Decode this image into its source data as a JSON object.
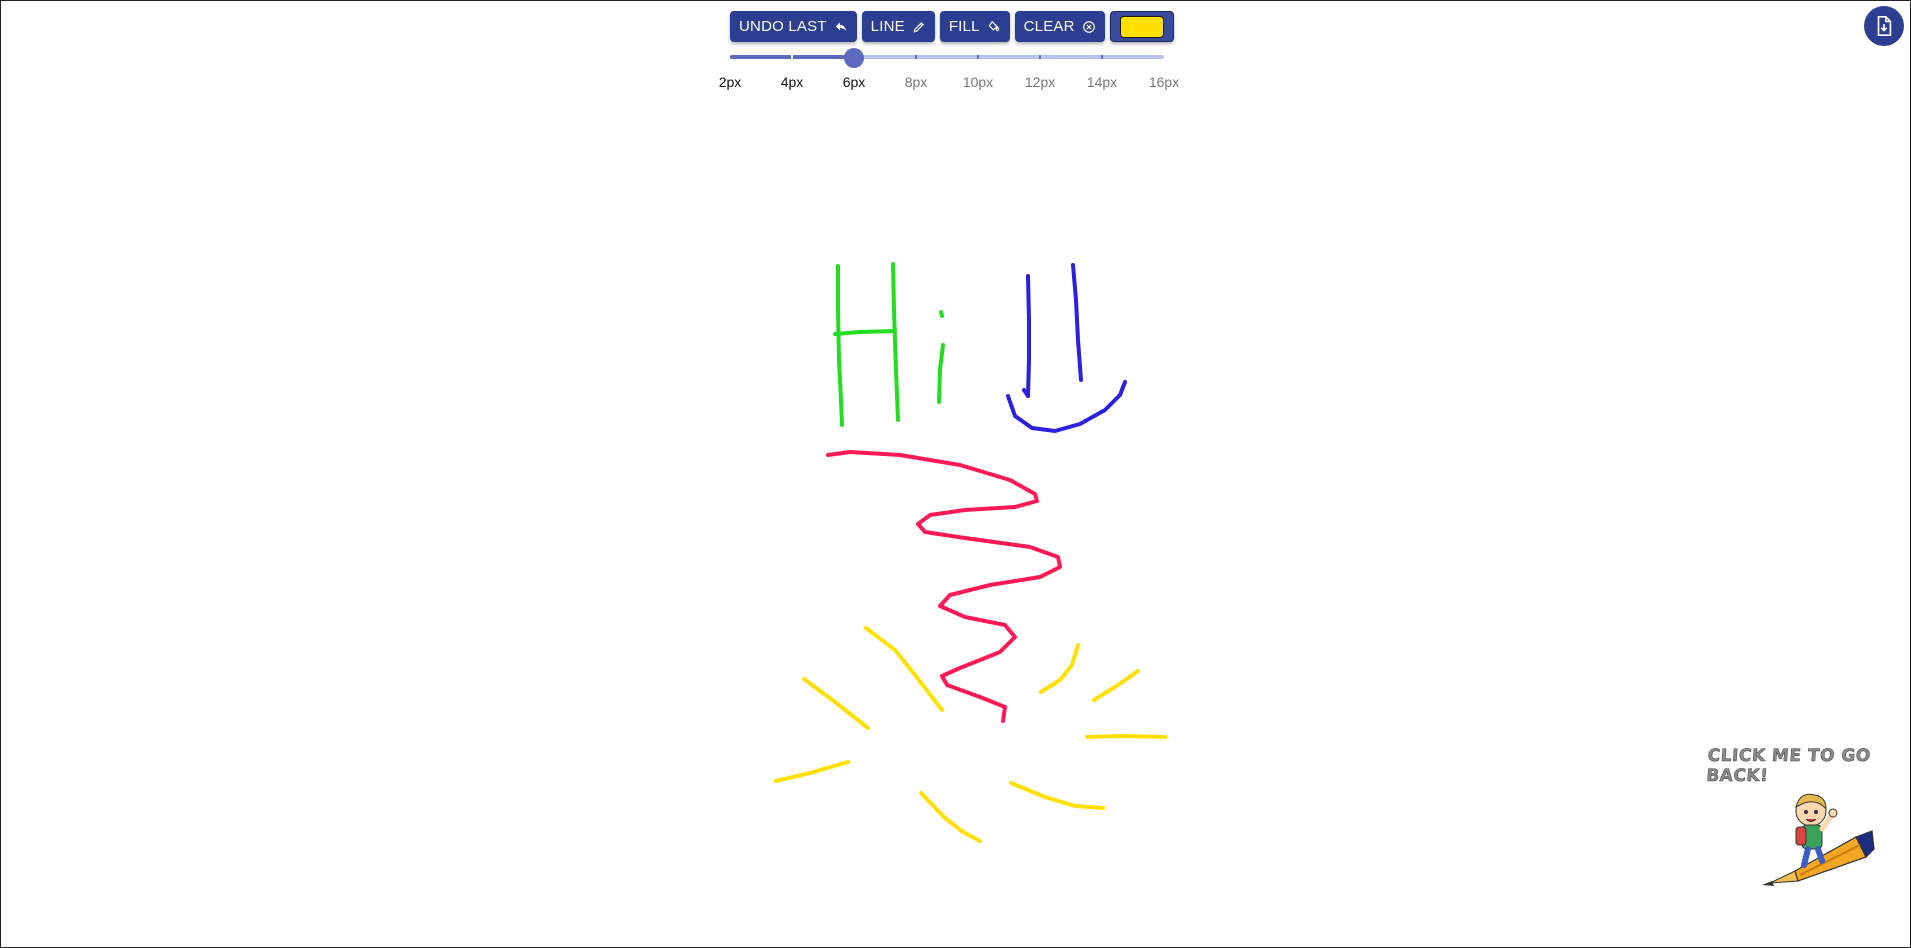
{
  "toolbar": {
    "undo_label": "UNDO LAST",
    "line_label": "LINE",
    "fill_label": "FILL",
    "clear_label": "CLEAR",
    "selected_color": "#ffe000"
  },
  "brush_size": {
    "options": [
      "2px",
      "4px",
      "6px",
      "8px",
      "10px",
      "12px",
      "14px",
      "16px"
    ],
    "selected": "6px",
    "accent": "#5c6bc0"
  },
  "icons": {
    "undo": "undo-arrow-icon",
    "line": "pencil-icon",
    "fill": "paint-bucket-icon",
    "clear": "close-circle-icon",
    "download": "file-download-icon"
  },
  "drawing": {
    "stroke_colors": {
      "green": "#22dd22",
      "blue": "#2b1fe0",
      "red": "#ff1a55",
      "yellow": "#ffe000"
    }
  },
  "back_link": {
    "label": "CLICK ME TO GO BACK!"
  }
}
